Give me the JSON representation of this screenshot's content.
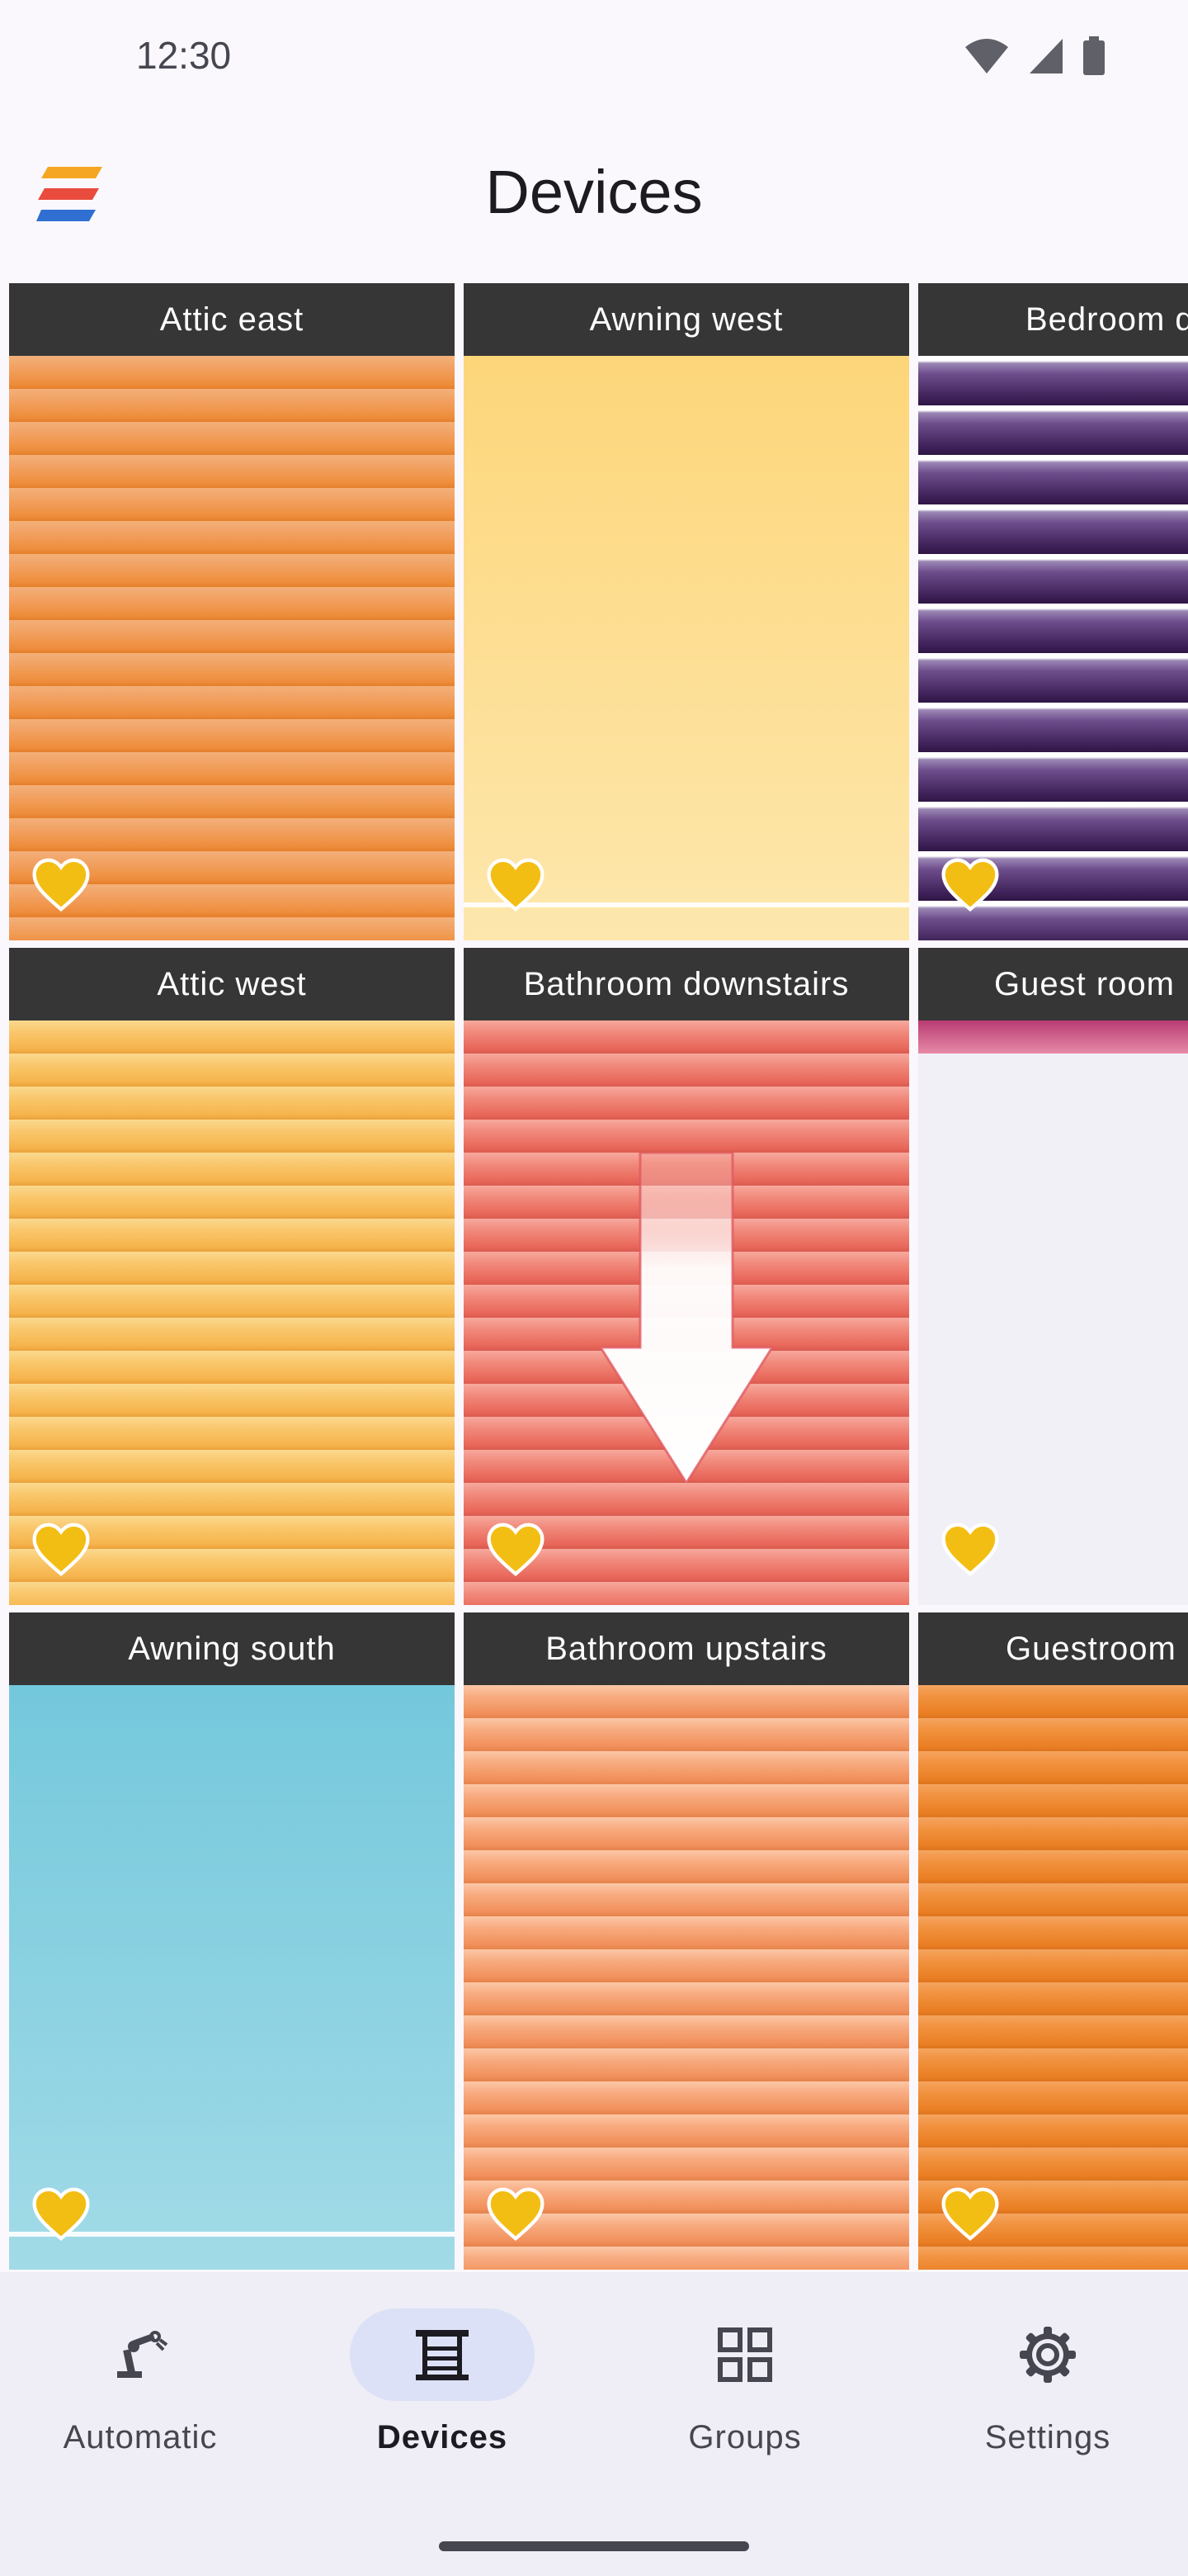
{
  "status_bar": {
    "time": "12:30",
    "icons": [
      "wifi-icon",
      "cell-signal-icon",
      "battery-icon"
    ]
  },
  "app_bar": {
    "title": "Devices",
    "logo_icon": "stacked-stripes-logo",
    "logo_colors": [
      "#f5a623",
      "#e94b3c",
      "#2f6fd1"
    ]
  },
  "devices": [
    {
      "name": "Attic east",
      "style": "orange-blind",
      "favorite": true
    },
    {
      "name": "Awning west",
      "style": "yellow-awning",
      "favorite": true
    },
    {
      "name": "Bedroom d",
      "style": "purple-blind",
      "favorite": true
    },
    {
      "name": "Attic west",
      "style": "amber-blind",
      "favorite": true
    },
    {
      "name": "Bathroom downstairs",
      "style": "salmon-blind",
      "favorite": true,
      "indicator": "down-arrow-icon"
    },
    {
      "name": "Guest room",
      "style": "empty",
      "favorite": true
    },
    {
      "name": "Awning south",
      "style": "blue-awning",
      "favorite": true
    },
    {
      "name": "Bathroom upstairs",
      "style": "peach-blind",
      "favorite": true
    },
    {
      "name": "Guestroom",
      "style": "deep-orange-blind",
      "favorite": true
    }
  ],
  "favorite_color": "#f3be14",
  "bottom_nav": {
    "active": "Devices",
    "items": [
      {
        "label": "Automatic",
        "icon": "robot-arm-icon"
      },
      {
        "label": "Devices",
        "icon": "blinds-icon"
      },
      {
        "label": "Groups",
        "icon": "grid-icon"
      },
      {
        "label": "Settings",
        "icon": "gear-icon"
      }
    ]
  }
}
